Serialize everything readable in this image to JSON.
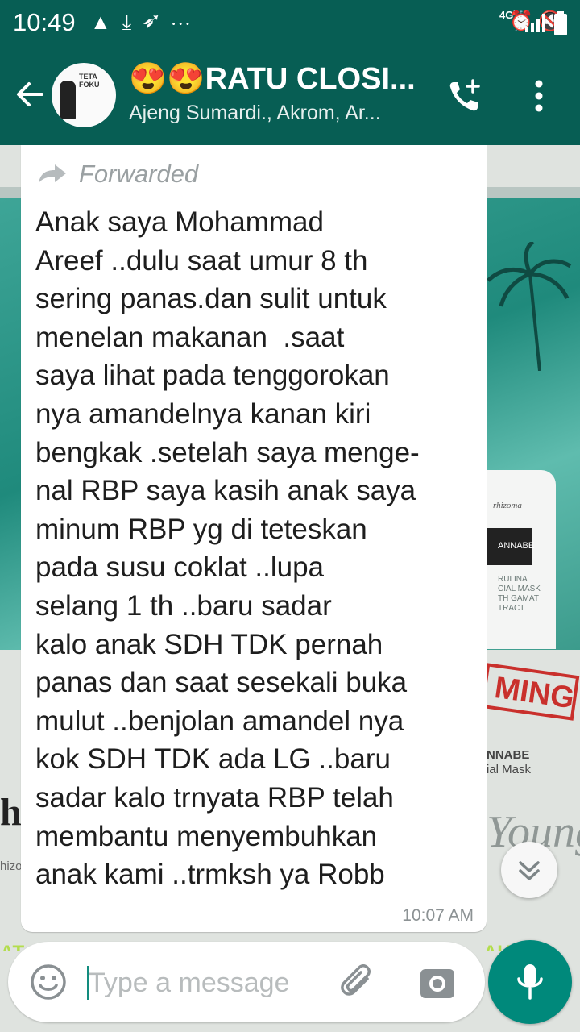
{
  "status_bar": {
    "time": "10:49",
    "network": "4G",
    "icons": [
      "drive-icon",
      "download-icon",
      "twitter-icon",
      "more-dots-icon",
      "alarm-icon",
      "mute-icon",
      "signal-icon",
      "battery-icon"
    ]
  },
  "header": {
    "group_name": "😍😍RATU CLOSI...",
    "members": "Ajeng Sumardi., Akrom, Ar...",
    "avatar_text": "TETA FOKU"
  },
  "message": {
    "forwarded_label": "Forwarded",
    "lines": [
      "Anak saya Mohammad",
      "Areef ..dulu saat umur 8 th",
      "sering panas.dan sulit untuk",
      "menelan makanan  .saat",
      "saya lihat pada tenggorokan",
      "nya amandelnya kanan kiri",
      "bengkak .setelah saya menge-",
      "nal RBP saya kasih anak saya",
      "minum RBP yg di teteskan",
      "pada susu coklat ..lupa",
      "selang 1 th ..baru sadar",
      "kalo anak SDH TDK pernah",
      "panas dan saat sesekali buka",
      "mulut ..benjolan amandel nya",
      "kok SDH TDK ada LG ..baru",
      "sadar kalo trnyata RBP telah",
      "membantu menyembuhkan",
      "anak kami ..trmksh ya Robb"
    ],
    "timestamp": "10:07 AM"
  },
  "wallpaper": {
    "tube_brand": "rhizoma",
    "tube_label": "ANNABE",
    "tube_small": [
      "RULINA",
      "CIAL MASK",
      "TH GAMAT",
      "TRACT"
    ],
    "stamp": "MING",
    "product_name": "NNABE",
    "product_sub": "ial Mask",
    "left_letter": "h",
    "left_small": "hizo",
    "script_text": "Young",
    "bottom_left": "AT",
    "bottom_right": "AU  IL"
  },
  "input": {
    "placeholder": "Type a message"
  },
  "colors": {
    "primary": "#075e54",
    "accent": "#00897b"
  }
}
